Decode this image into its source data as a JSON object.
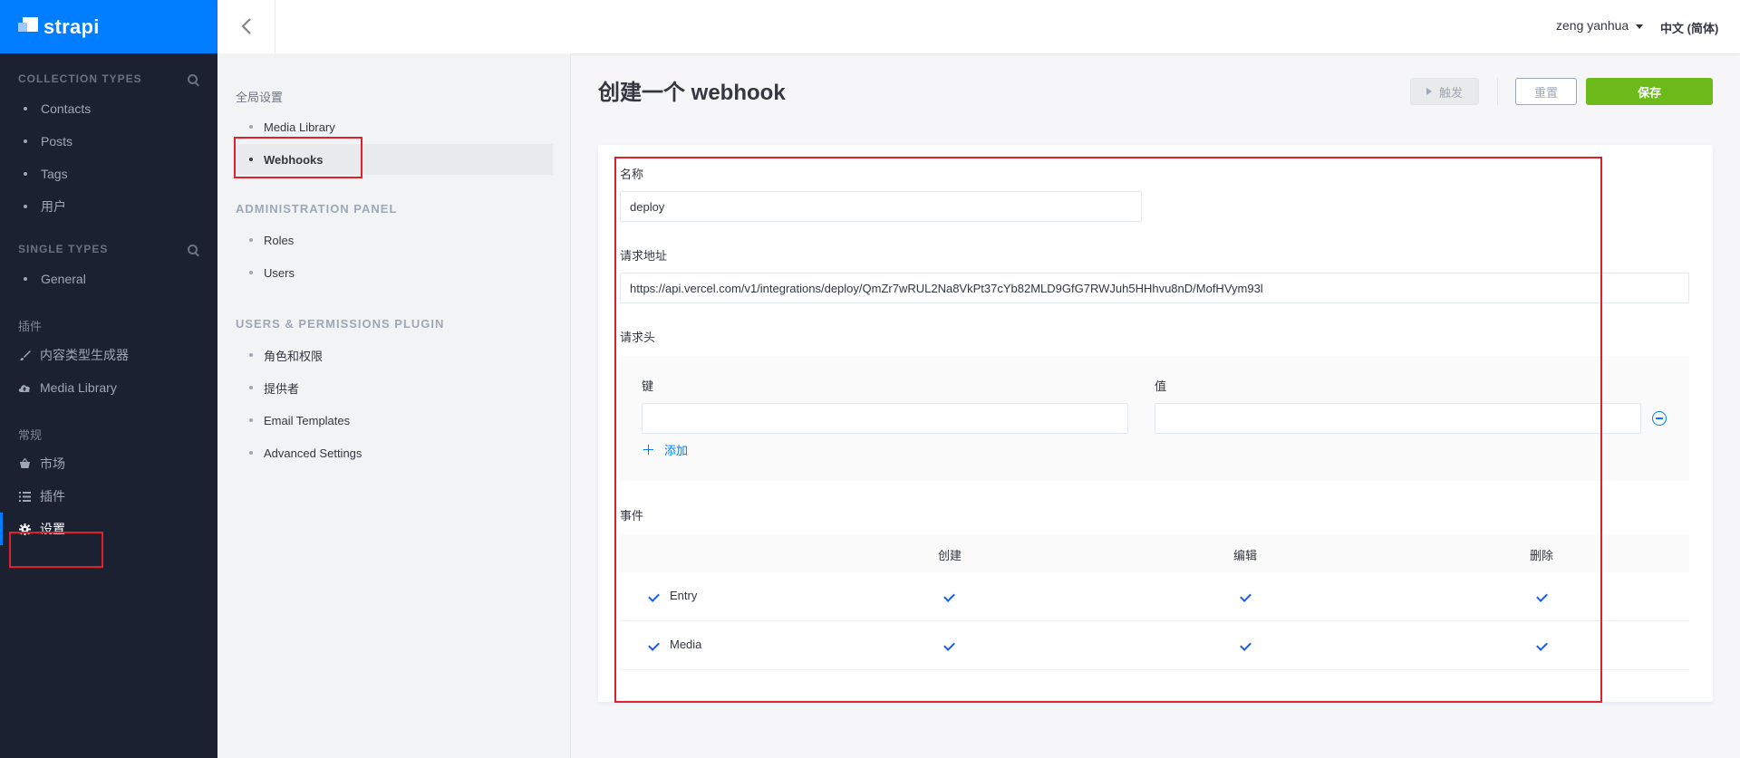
{
  "brand": {
    "name": "strapi"
  },
  "leftnav": {
    "collection_types": {
      "heading": "COLLECTION TYPES",
      "items": [
        "Contacts",
        "Posts",
        "Tags",
        "用户"
      ]
    },
    "single_types": {
      "heading": "SINGLE TYPES",
      "items": [
        "General"
      ]
    },
    "plugins": {
      "heading": "插件",
      "items": [
        {
          "label": "内容类型生成器",
          "icon": "brush-icon"
        },
        {
          "label": "Media Library",
          "icon": "cloud-upload-icon"
        }
      ]
    },
    "general": {
      "heading": "常规",
      "items": [
        {
          "label": "市场",
          "icon": "basket-icon"
        },
        {
          "label": "插件",
          "icon": "list-icon"
        },
        {
          "label": "设置",
          "icon": "gear-icon",
          "active": true
        }
      ]
    }
  },
  "topbar": {
    "user": "zeng yanhua",
    "language": "中文 (简体)"
  },
  "subnav": {
    "global": {
      "heading": "全局设置",
      "items": [
        "Media Library",
        "Webhooks"
      ],
      "active": "Webhooks"
    },
    "admin": {
      "heading": "ADMINISTRATION PANEL",
      "items": [
        "Roles",
        "Users"
      ]
    },
    "users_permissions": {
      "heading": "USERS & PERMISSIONS PLUGIN",
      "items": [
        "角色和权限",
        "提供者",
        "Email Templates",
        "Advanced Settings"
      ]
    }
  },
  "main": {
    "title": "创建一个 webhook",
    "buttons": {
      "trigger": "触发",
      "reset": "重置",
      "save": "保存"
    },
    "form": {
      "name_label": "名称",
      "name_value": "deploy",
      "url_label": "请求地址",
      "url_value": "https://api.vercel.com/v1/integrations/deploy/QmZr7wRUL2Na8VkPt37cYb82MLD9GfG7RWJuh5HHhvu8nD/MofHVym93l",
      "headers_label": "请求头",
      "key_label": "键",
      "value_label": "值",
      "add_label": "添加",
      "events_label": "事件",
      "event_columns": [
        "创建",
        "编辑",
        "删除"
      ],
      "event_rows": [
        {
          "label": "Entry",
          "all": true,
          "create": true,
          "update": true,
          "delete": true
        },
        {
          "label": "Media",
          "all": true,
          "create": true,
          "update": true,
          "delete": true
        }
      ]
    }
  },
  "colors": {
    "brand": "#007eff",
    "nav_bg": "#1b2130",
    "save": "#6dbb1a",
    "highlight": "#e0202a"
  }
}
